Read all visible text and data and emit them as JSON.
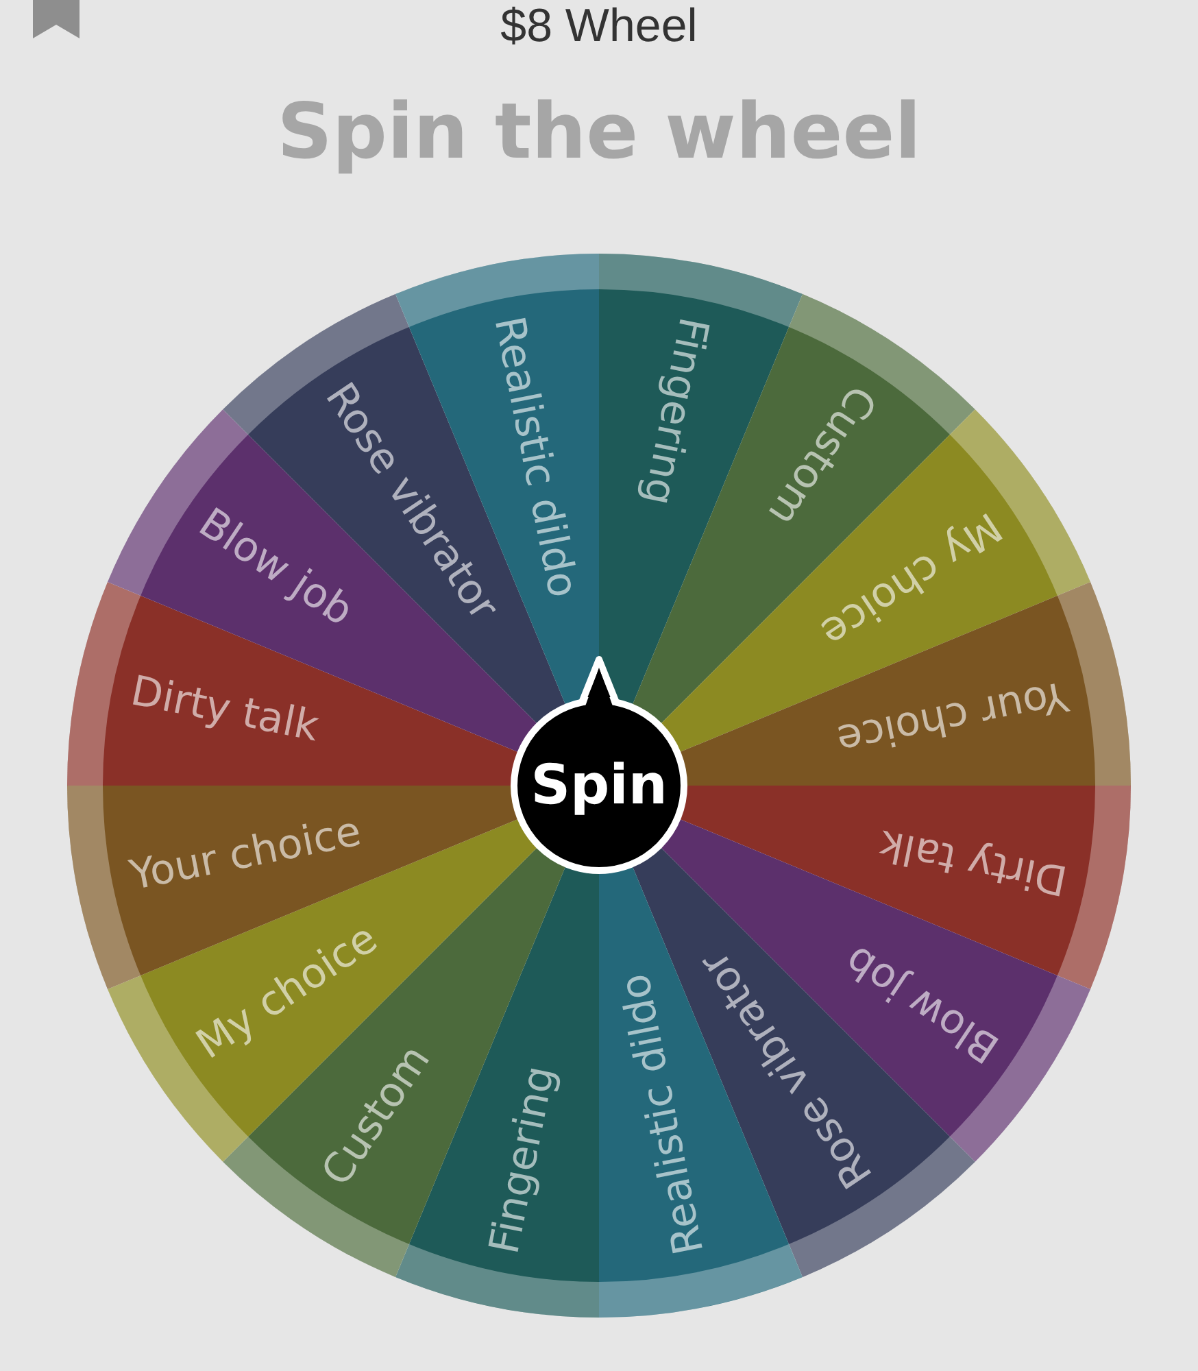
{
  "top_bar": {
    "title": "$8 Wheel"
  },
  "heading": "Spin the wheel",
  "wheel": {
    "spin_button": "Spin",
    "segments": [
      {
        "label": "Fingering",
        "color": "#1e5a58"
      },
      {
        "label": "Custom",
        "color": "#4c6a3c"
      },
      {
        "label": "My choice",
        "color": "#8c8a22"
      },
      {
        "label": "Your choice",
        "color": "#7a5522"
      },
      {
        "label": "Dirty talk",
        "color": "#8a3028"
      },
      {
        "label": "Blow job",
        "color": "#5c306c"
      },
      {
        "label": "Rose vibrator",
        "color": "#363d5a"
      },
      {
        "label": "Realistic dildo",
        "color": "#24687a"
      },
      {
        "label": "Fingering",
        "color": "#1e5a58"
      },
      {
        "label": "Custom",
        "color": "#4c6a3c"
      },
      {
        "label": "My choice",
        "color": "#8c8a22"
      },
      {
        "label": "Your choice",
        "color": "#7a5522"
      },
      {
        "label": "Dirty talk",
        "color": "#8a3028"
      },
      {
        "label": "Blow job",
        "color": "#5c306c"
      },
      {
        "label": "Rose vibrator",
        "color": "#363d5a"
      },
      {
        "label": "Realistic dildo",
        "color": "#24687a"
      }
    ]
  }
}
